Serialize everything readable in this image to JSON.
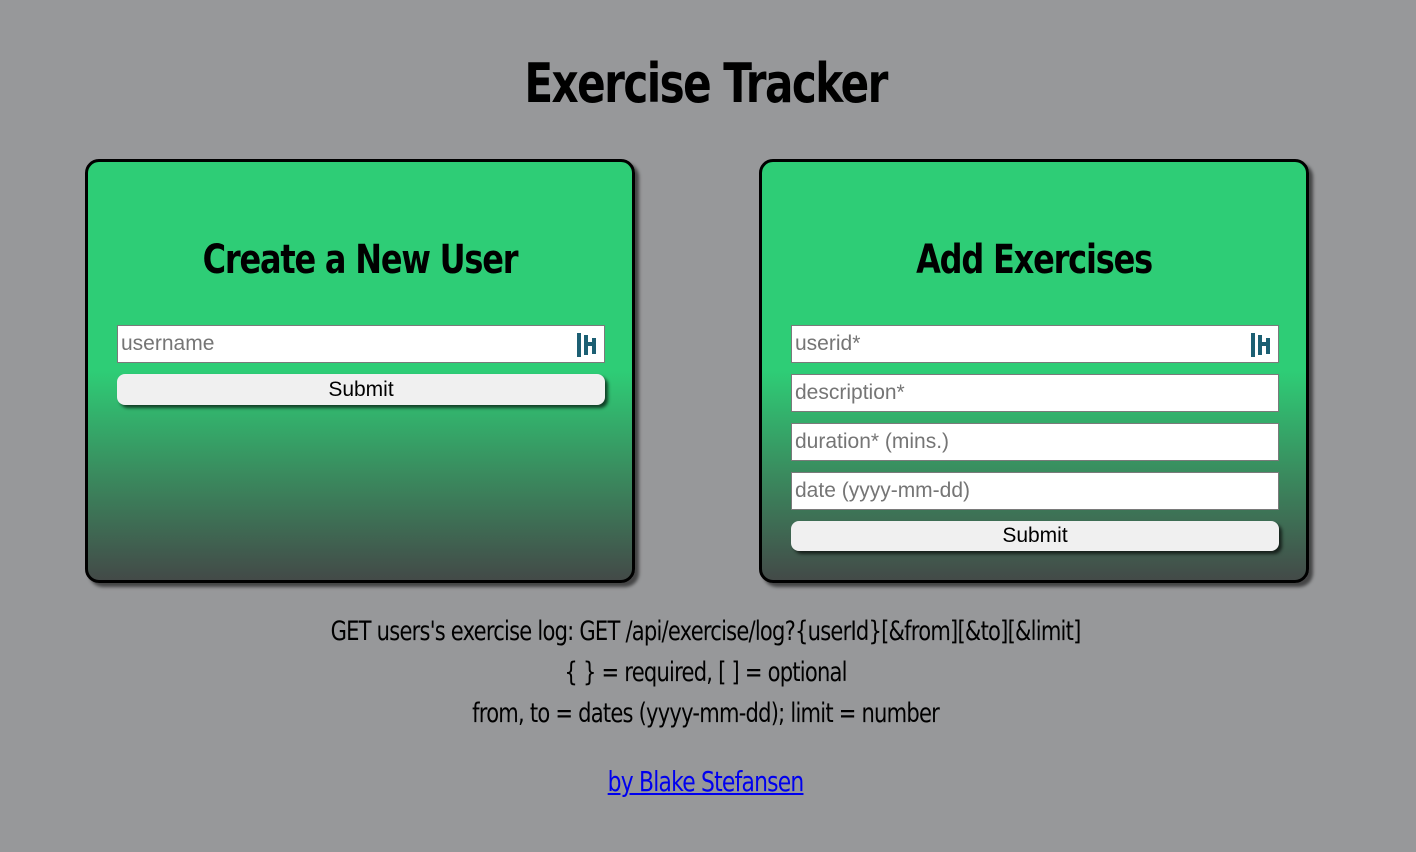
{
  "page": {
    "title": "Exercise Tracker"
  },
  "create_user": {
    "heading": "Create a New User",
    "username_placeholder": "username",
    "submit_label": "Submit"
  },
  "add_exercises": {
    "heading": "Add Exercises",
    "userid_placeholder": "userid*",
    "description_placeholder": "description*",
    "duration_placeholder": "duration* (mins.)",
    "date_placeholder": "date (yyyy-mm-dd)",
    "submit_label": "Submit"
  },
  "info": {
    "line1": "GET users's exercise log: GET /api/exercise/log?{userId}[&from][&to][&limit]",
    "line2": "{ } = required, [ ] = optional",
    "line3": "from, to = dates (yyyy-mm-dd); limit = number"
  },
  "footer": {
    "author_link": "by Blake Stefansen"
  },
  "colors": {
    "background": "#97989a",
    "card_green": "#2ecd76",
    "card_bottom": "#434a48",
    "link": "#0000ee",
    "field_icon": "#1c5f73"
  },
  "icons": {
    "field_icon": "password-manager-icon"
  }
}
